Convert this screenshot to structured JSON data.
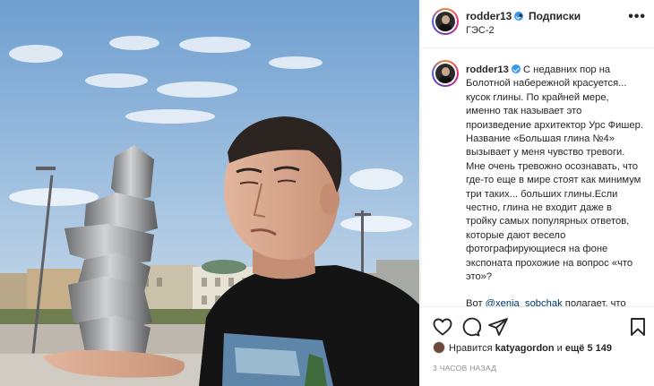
{
  "post": {
    "username": "rodder13",
    "separator": "•",
    "follow_label": "Подписки",
    "location": "ГЭС-2",
    "more_label": "•••"
  },
  "caption": {
    "username": "rodder13",
    "paragraph1": "С недавних пор на Болотной набережной красуется... кусок глины. По крайней мере, именно так называет это произведение архитектор Урс Фишер. Название «Большая глина №4» вызывает у меня чувство тревоги. Мне очень тревожно осознавать, что где-то еще в мире стоят как минимум три таких... больших глины.Если честно, глина не входит даже в тройку самых популярных ответов, которые дают весело фотографирующиеся на фоне экспоната прохожие на вопрос «что это»?",
    "paragraph2_prefix": "Вот ",
    "mention": "@xenia_sobchak",
    "paragraph2_rest": " полагает, что беда в зрителях, что не хватает им"
  },
  "actions": {
    "like_icon": "heart-icon",
    "comment_icon": "comment-icon",
    "share_icon": "share-icon",
    "save_icon": "bookmark-icon"
  },
  "likes": {
    "prefix": "Нравится ",
    "user": "katyagordon",
    "middle": " и ",
    "count": "ещё 5 149"
  },
  "timestamp": "3 ЧАСОВ НАЗАД",
  "colors": {
    "accent": "#3897f0",
    "text": "#262626",
    "muted": "#8e8e8e",
    "mention": "#00376b",
    "divider": "#efefef"
  }
}
